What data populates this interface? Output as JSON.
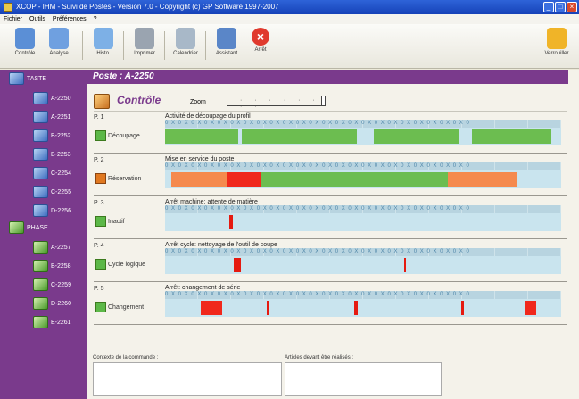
{
  "window": {
    "title": "XCOP - IHM - Suivi de Postes - Version 7.0 - Copyright (c) GP Software 1997-2007",
    "buttons": [
      "_",
      "□",
      "×"
    ]
  },
  "menu": [
    "Fichier",
    "Outils",
    "Préférences",
    "?"
  ],
  "toolbar": [
    {
      "label": "Contrôle",
      "icon": "control-icon",
      "color": "#5b8fd6"
    },
    {
      "label": "Analyse",
      "icon": "analysis-icon",
      "color": "#6fa0e0"
    },
    {
      "label": "Histo.",
      "icon": "history-icon",
      "color": "#7db0e6"
    },
    {
      "label": "Imprimer",
      "icon": "printer-icon",
      "color": "#9aa4b0"
    },
    {
      "label": "Calendrier",
      "icon": "calendar-icon",
      "color": "#a8b8c8"
    },
    {
      "label": "Assistant",
      "icon": "assistant-icon",
      "color": "#5a86c8"
    },
    {
      "label": "Arrêt",
      "icon": "stop-icon",
      "color": "#e03a2e"
    },
    {
      "label": "Verrouiller",
      "icon": "lock-icon",
      "color": "#f0b428"
    }
  ],
  "sidebar": {
    "groups": [
      {
        "label": "TASTE",
        "items": [
          "A-2250",
          "A-2251",
          "B-2252",
          "B-2253",
          "C-2254",
          "C-2255",
          "D-2256"
        ]
      },
      {
        "label": "PHASE",
        "items": [
          "A-2257",
          "B-2258",
          "C-2259",
          "D-2260",
          "E-2261"
        ]
      }
    ]
  },
  "poste": {
    "title": "Poste : A-2250"
  },
  "control": {
    "title": "Contrôle",
    "zoom_label": "Zoom",
    "zoom_ticks": "· · · · · · · ·"
  },
  "timeline": {
    "ruler_text": "0 X 0  X 0  X 0  X 0  X 0  X 0  X 0  X 0  X 0  X 0  X 0  X 0  X 0  X 0  X 0  X 0  X 0  X 0  X 0  X 0  X 0  X 0  X 0"
  },
  "tracks": [
    {
      "p": "P. 1",
      "name": "Activité de découpage du profil",
      "status": "Découpage",
      "status_color": "green",
      "segments": [
        {
          "s": 0.0,
          "e": 0.185,
          "c": "#6cbd50"
        },
        {
          "s": 0.194,
          "e": 0.485,
          "c": "#6cbd50"
        },
        {
          "s": 0.528,
          "e": 0.74,
          "c": "#6cbd50"
        },
        {
          "s": 0.775,
          "e": 0.975,
          "c": "#6cbd50"
        }
      ]
    },
    {
      "p": "P. 2",
      "name": "Mise en service du poste",
      "status": "Réservation",
      "status_color": "orange",
      "segments": [
        {
          "s": 0.016,
          "e": 0.155,
          "c": "#f58a4e"
        },
        {
          "s": 0.155,
          "e": 0.24,
          "c": "#f0281c"
        },
        {
          "s": 0.24,
          "e": 0.715,
          "c": "#6cbd50"
        },
        {
          "s": 0.715,
          "e": 0.89,
          "c": "#f58a4e"
        }
      ]
    },
    {
      "p": "P. 3",
      "name": "Arrêt machine: attente de matière",
      "status": "Inactif",
      "status_color": "green",
      "segments": [
        {
          "s": 0.163,
          "e": 0.171,
          "c": "#e51a10"
        }
      ]
    },
    {
      "p": "P. 4",
      "name": "Arrêt cycle: nettoyage de l'outil de coupe",
      "status": "Cycle logique",
      "status_color": "green",
      "segments": [
        {
          "s": 0.173,
          "e": 0.191,
          "c": "#e51a10"
        },
        {
          "s": 0.603,
          "e": 0.609,
          "c": "#e51a10"
        }
      ]
    },
    {
      "p": "P. 5",
      "name": "Arrêt: changement de série",
      "status": "Changement",
      "status_color": "green",
      "segments": [
        {
          "s": 0.09,
          "e": 0.145,
          "c": "#f0281c"
        },
        {
          "s": 0.257,
          "e": 0.264,
          "c": "#e51a10"
        },
        {
          "s": 0.477,
          "e": 0.487,
          "c": "#e51a10"
        },
        {
          "s": 0.748,
          "e": 0.755,
          "c": "#e51a10"
        },
        {
          "s": 0.908,
          "e": 0.937,
          "c": "#f0281c"
        }
      ]
    }
  ],
  "bottom": {
    "left_label": "Contexte de la commande :",
    "right_label": "Articles devant être réalisés :"
  }
}
